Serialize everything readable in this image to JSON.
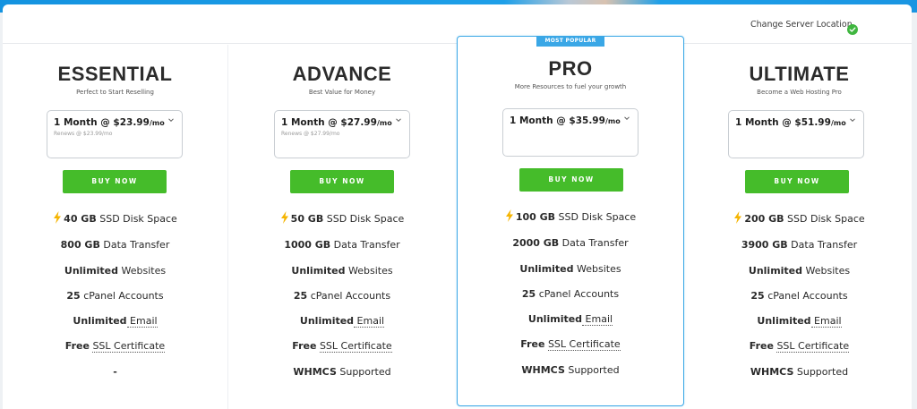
{
  "header": {
    "server_location_label": "Change Server Location",
    "status_icon": "check-circle-icon"
  },
  "colors": {
    "accent_blue": "#3aa7e6",
    "buy_green": "#45bc2a",
    "check_green": "#3fb63f",
    "bolt_yellow": "#f5b400"
  },
  "plans": [
    {
      "name": "ESSENTIAL",
      "tagline": "Perfect to Start Reselling",
      "term_price": "1 Month @ $23.99",
      "term_unit": "/mo",
      "renews": "Renews @ $23.99/mo",
      "buy_label": "BUY NOW",
      "features": [
        {
          "bold": "40 GB",
          "text": " SSD Disk Space"
        },
        {
          "bold": "800 GB",
          "text": " Data Transfer"
        },
        {
          "bold": "Unlimited",
          "text": " Websites"
        },
        {
          "bold": "25",
          "text": " cPanel Accounts"
        },
        {
          "bold": "Unlimited",
          "text": " Email"
        },
        {
          "bold": "Free",
          "text": " SSL Certificate"
        },
        {
          "bold": "-",
          "text": ""
        }
      ]
    },
    {
      "name": "ADVANCE",
      "tagline": "Best Value for Money",
      "term_price": "1 Month @ $27.99",
      "term_unit": "/mo",
      "renews": "Renews @ $27.99/mo",
      "buy_label": "BUY NOW",
      "features": [
        {
          "bold": "50 GB",
          "text": " SSD Disk Space"
        },
        {
          "bold": "1000 GB",
          "text": " Data Transfer"
        },
        {
          "bold": "Unlimited",
          "text": " Websites"
        },
        {
          "bold": "25",
          "text": " cPanel Accounts"
        },
        {
          "bold": "Unlimited",
          "text": " Email"
        },
        {
          "bold": "Free",
          "text": " SSL Certificate"
        },
        {
          "bold": "WHMCS",
          "text": " Supported"
        }
      ]
    },
    {
      "name": "PRO",
      "badge": "MOST POPULAR",
      "tagline": "More Resources to fuel your growth",
      "term_price": "1 Month @ $35.99",
      "term_unit": "/mo",
      "renews": "",
      "buy_label": "BUY NOW",
      "features": [
        {
          "bold": "100 GB",
          "text": " SSD Disk Space"
        },
        {
          "bold": "2000 GB",
          "text": " Data Transfer"
        },
        {
          "bold": "Unlimited",
          "text": " Websites"
        },
        {
          "bold": "25",
          "text": " cPanel Accounts"
        },
        {
          "bold": "Unlimited",
          "text": " Email"
        },
        {
          "bold": "Free",
          "text": " SSL Certificate"
        },
        {
          "bold": "WHMCS",
          "text": " Supported"
        }
      ]
    },
    {
      "name": "ULTIMATE",
      "tagline": "Become a Web Hosting Pro",
      "term_price": "1 Month @ $51.99",
      "term_unit": "/mo",
      "renews": "",
      "buy_label": "BUY NOW",
      "features": [
        {
          "bold": "200 GB",
          "text": " SSD Disk Space"
        },
        {
          "bold": "3900 GB",
          "text": " Data Transfer"
        },
        {
          "bold": "Unlimited",
          "text": " Websites"
        },
        {
          "bold": "25",
          "text": " cPanel Accounts"
        },
        {
          "bold": "Unlimited",
          "text": " Email"
        },
        {
          "bold": "Free",
          "text": " SSL Certificate"
        },
        {
          "bold": "WHMCS",
          "text": " Supported"
        }
      ]
    }
  ]
}
